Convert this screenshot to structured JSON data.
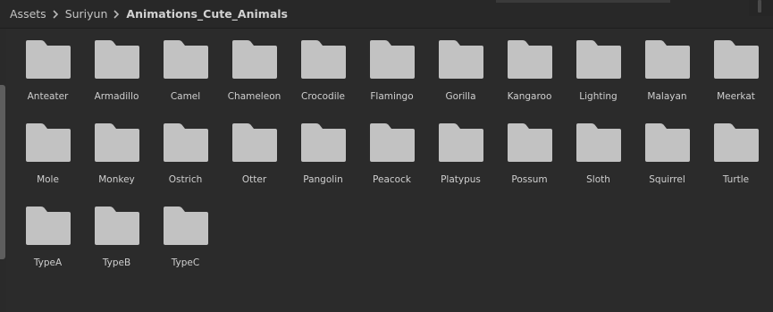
{
  "breadcrumb": {
    "items": [
      "Assets",
      "Suriyun",
      "Animations_Cute_Animals"
    ]
  },
  "folders": [
    "Anteater",
    "Armadillo",
    "Camel",
    "Chameleon",
    "Crocodile",
    "Flamingo",
    "Gorilla",
    "Kangaroo",
    "Lighting",
    "Malayan",
    "Meerkat",
    "Mole",
    "Monkey",
    "Ostrich",
    "Otter",
    "Pangolin",
    "Peacock",
    "Platypus",
    "Possum",
    "Sloth",
    "Squirrel",
    "Turtle",
    "TypeA",
    "TypeB",
    "TypeC"
  ],
  "icons": {
    "folder": "folder-icon",
    "separator": "chevron-right-icon"
  },
  "colors": {
    "background": "#2b2b2b",
    "folder": "#c2c2c2",
    "text": "#cfcfcf"
  }
}
